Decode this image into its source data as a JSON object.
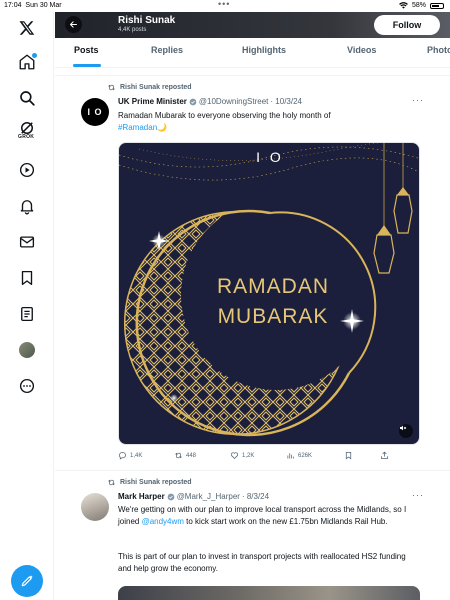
{
  "status_bar": {
    "time": "17:04",
    "date": "Sun 30 Mar",
    "battery": "58%"
  },
  "sidebar": {
    "items": [
      {
        "name": "x-logo-icon"
      },
      {
        "name": "home-icon"
      },
      {
        "name": "search-icon"
      },
      {
        "name": "grok-icon",
        "label": "GROK"
      },
      {
        "name": "video-icon"
      },
      {
        "name": "bell-icon"
      },
      {
        "name": "mail-icon"
      },
      {
        "name": "bookmark-icon"
      },
      {
        "name": "list-icon"
      },
      {
        "name": "avatar"
      },
      {
        "name": "more-icon"
      }
    ],
    "grok_label": "GROK"
  },
  "header": {
    "name": "Rishi Sunak",
    "posts_count": "4,4K posts",
    "follow_label": "Follow"
  },
  "tabs": [
    {
      "label": "Posts",
      "active": true
    },
    {
      "label": "Replies"
    },
    {
      "label": "Highlights"
    },
    {
      "label": "Videos"
    },
    {
      "label": "Photo"
    }
  ],
  "tweets": [
    {
      "repost_label": "Rishi Sunak reposted",
      "avatar_text": "I O",
      "name": "UK Prime Minister",
      "handle": "@10DowningStreet",
      "date": "· 10/3/24",
      "text": "Ramadan Mubarak to everyone observing the holy month of",
      "hashtag": "#Ramadan",
      "media": {
        "logo": "I O",
        "line1": "RAMADAN",
        "line2": "MUBARAK"
      },
      "stats": {
        "replies": "1,4K",
        "reposts": "448",
        "likes": "1,2K",
        "views": "626K"
      }
    },
    {
      "repost_label": "Rishi Sunak reposted",
      "name": "Mark Harper",
      "handle": "@Mark_J_Harper",
      "date": "· 8/3/24",
      "text_1a": "We're getting on with our plan to improve local transport across the Midlands, so I joined ",
      "mention": "@andy4wm",
      "text_1b": " to kick start work on the new £1.75bn Midlands Rail Hub.",
      "text_2": "This is part of our plan to invest in transport projects with reallocated HS2 funding and help grow the economy."
    }
  ],
  "colors": {
    "accent": "#1d9bf0",
    "text": "#0f1419",
    "muted": "#536471",
    "media_bg": "#1b1f3b",
    "gold": "#d9b45a"
  }
}
